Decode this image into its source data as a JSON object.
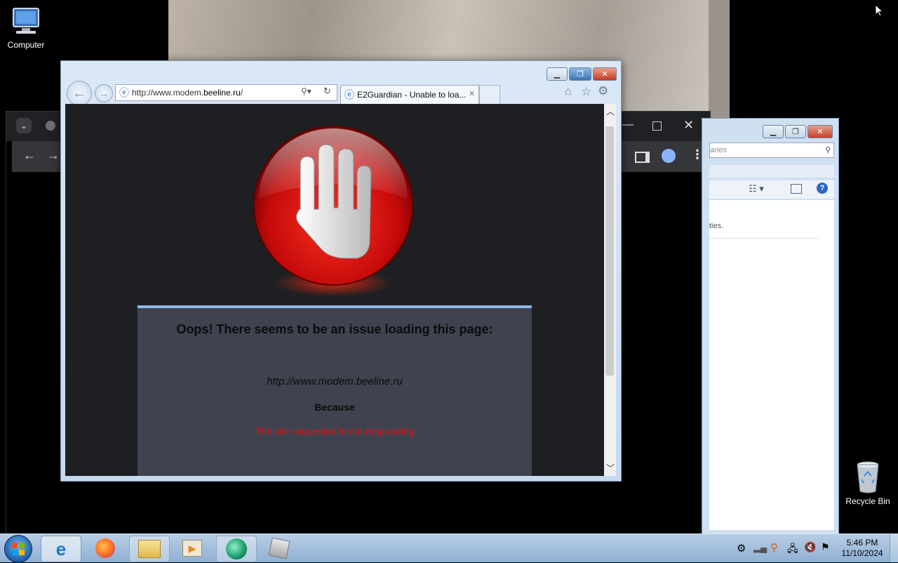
{
  "desktop": {
    "icons": [
      {
        "label": "Computer",
        "icon": "computer-icon"
      },
      {
        "label": "Recycle Bin",
        "icon": "recycle-bin-icon"
      }
    ]
  },
  "explorer_window": {
    "search_placeholder": "aries",
    "truncated_text": "ties."
  },
  "ie": {
    "address": {
      "prefix": "http://www.modem.",
      "domain": "beeline.ru",
      "suffix": "/"
    },
    "tab_title": "E2Guardian - Unable to loa...",
    "page": {
      "heading": "Oops! There seems to be an issue loading this page:",
      "url": "http://www.modem.beeline.ru",
      "because": "Because",
      "reason": "The site requested is not responding"
    }
  },
  "taskbar": {
    "apps": [
      "start-orb",
      "internet-explorer",
      "firefox",
      "file-explorer",
      "media-player",
      "app-green",
      "app-gray"
    ],
    "clock_time": "5:46 PM",
    "clock_date": "11/10/2024"
  },
  "colors": {
    "reason_text": "#e01010",
    "panel_bg": "#3f4350",
    "page_bg": "#1d1f22"
  }
}
